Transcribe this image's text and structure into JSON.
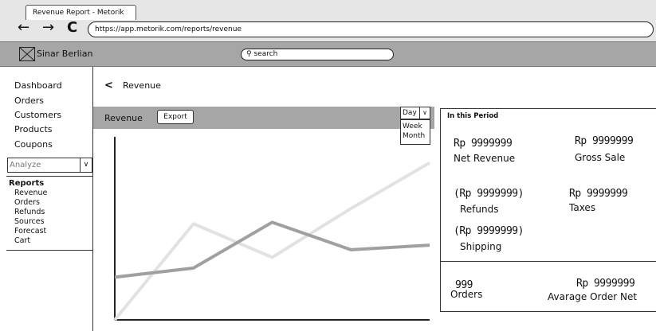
{
  "browser": {
    "tab_title": "Revenue Report - Metorik",
    "back": "←",
    "forward": "→",
    "reload": "C",
    "url": "https://app.metorik.com/reports/revenue"
  },
  "app": {
    "brand": "Sinar Berlian",
    "search_placeholder": "search"
  },
  "sidebar": {
    "links": [
      "Dashboard",
      "Orders",
      "Customers",
      "Products",
      "Coupons"
    ],
    "analyze_select": "Analyze",
    "reports_title": "Reports",
    "report_items": [
      "Revenue",
      "Orders",
      "Refunds",
      "Sources",
      "Forecast",
      "Cart"
    ]
  },
  "page": {
    "back_icon": "<",
    "title": "Revenue"
  },
  "panel": {
    "label": "Revenue",
    "export_label": "Export",
    "period_selected": "Day",
    "period_options": [
      "Week",
      "Month"
    ]
  },
  "stats": {
    "heading": "In this Period",
    "net_revenue_value": "Rp 9999999",
    "net_revenue_label": "Net Revenue",
    "gross_sale_value": "Rp 9999999",
    "gross_sale_label": "Gross Sale",
    "refunds_value": "(Rp 9999999)",
    "refunds_label": "Refunds",
    "taxes_value": "Rp 9999999",
    "taxes_label": "Taxes",
    "shipping_value": "(Rp 9999999)",
    "shipping_label": "Shipping",
    "orders_value": "999",
    "orders_label": "Orders",
    "aov_value": "Rp 9999999",
    "aov_label": "Avarage Order Net"
  },
  "chart_data": {
    "type": "line",
    "x": [
      0,
      1,
      2,
      3,
      4
    ],
    "series": [
      {
        "values": [
          0.08,
          0.14,
          0.44,
          0.26,
          0.29
        ],
        "color": "#a0a0a0"
      },
      {
        "values": [
          -0.2,
          0.43,
          0.21,
          0.53,
          0.83
        ],
        "color": "#e2e2e2"
      }
    ],
    "xlim": [
      0,
      4
    ],
    "ylim": [
      -0.2,
      1
    ],
    "colors": {
      "axis": "#222222"
    }
  }
}
